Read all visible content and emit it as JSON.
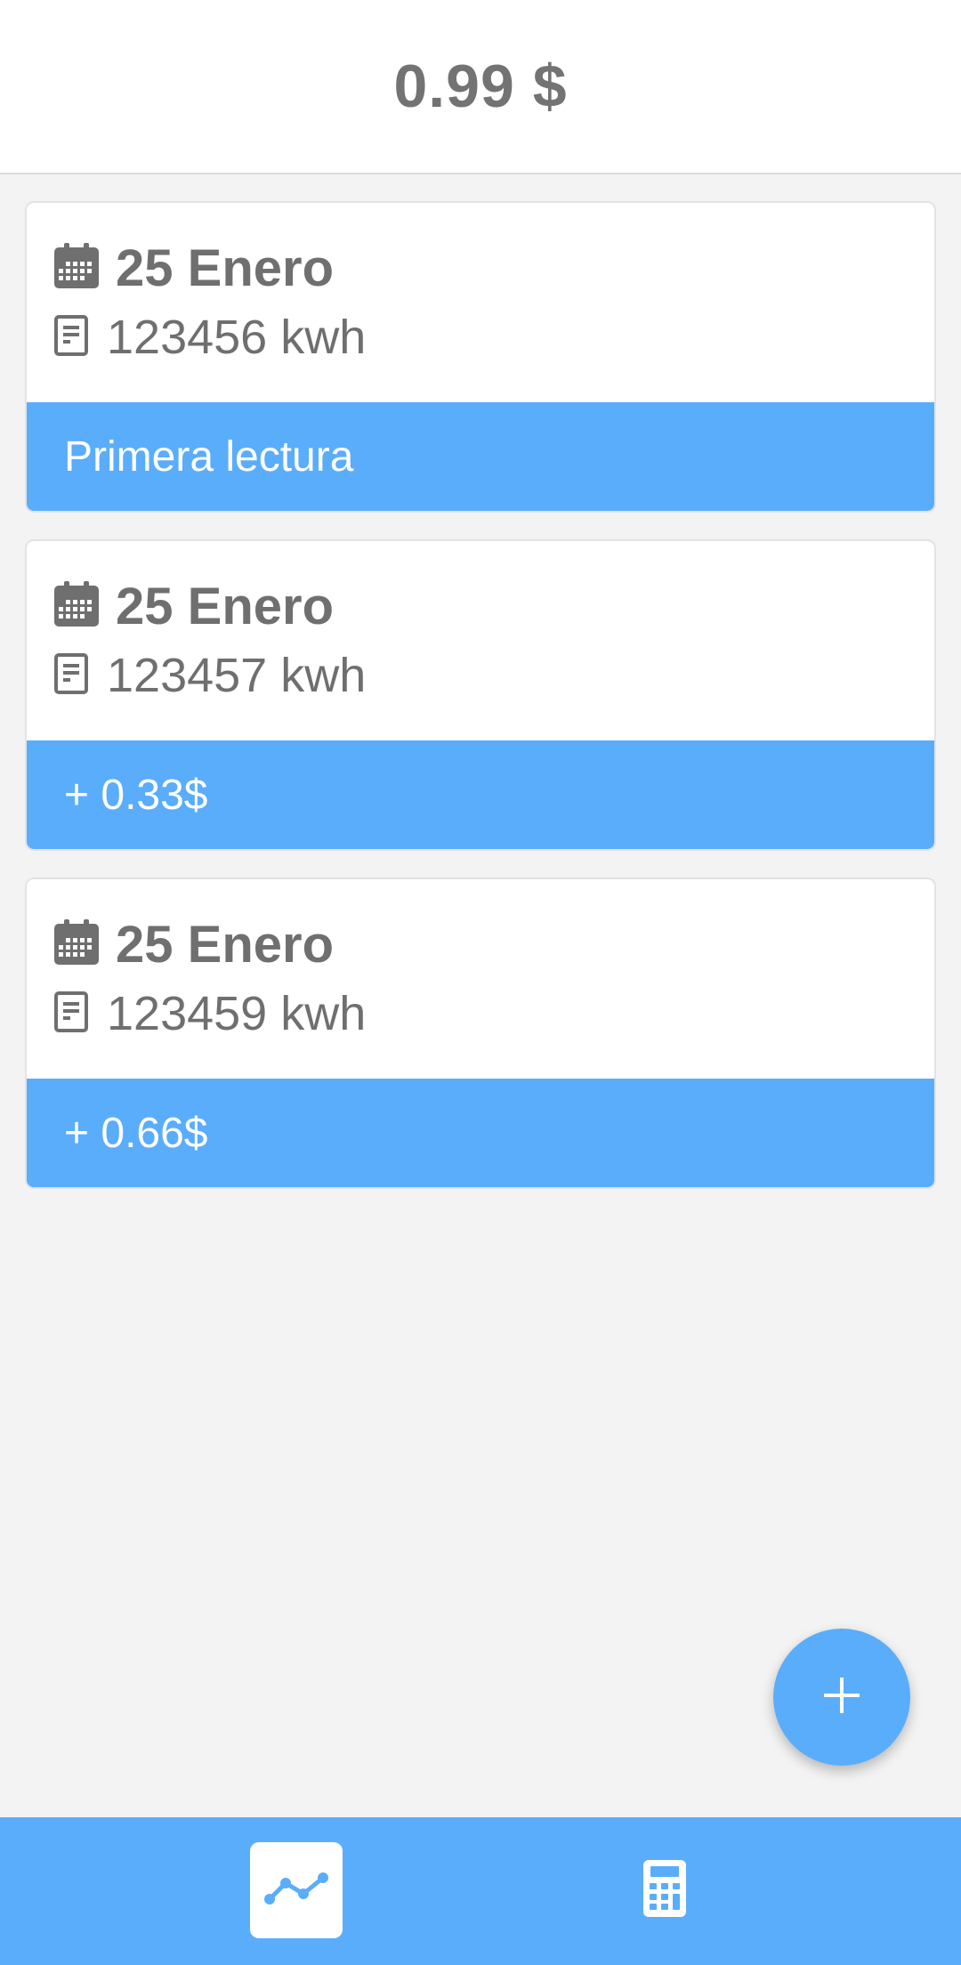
{
  "header": {
    "total": "0.99 $"
  },
  "readings": [
    {
      "date": "25 Enero",
      "reading": "123456 kwh",
      "footer": "Primera lectura"
    },
    {
      "date": "25 Enero",
      "reading": "123457 kwh",
      "footer": "+ 0.33$"
    },
    {
      "date": "25 Enero",
      "reading": "123459 kwh",
      "footer": "+ 0.66$"
    }
  ],
  "icons": {
    "date": "calendar-icon",
    "reading": "document-icon",
    "fab": "plus-icon",
    "nav_chart": "chart-line-icon",
    "nav_calc": "calculator-icon"
  },
  "colors": {
    "accent": "#5aadfb",
    "text": "#6f6f6f",
    "background": "#f3f3f3"
  },
  "nav": {
    "active_tab": "chart"
  }
}
